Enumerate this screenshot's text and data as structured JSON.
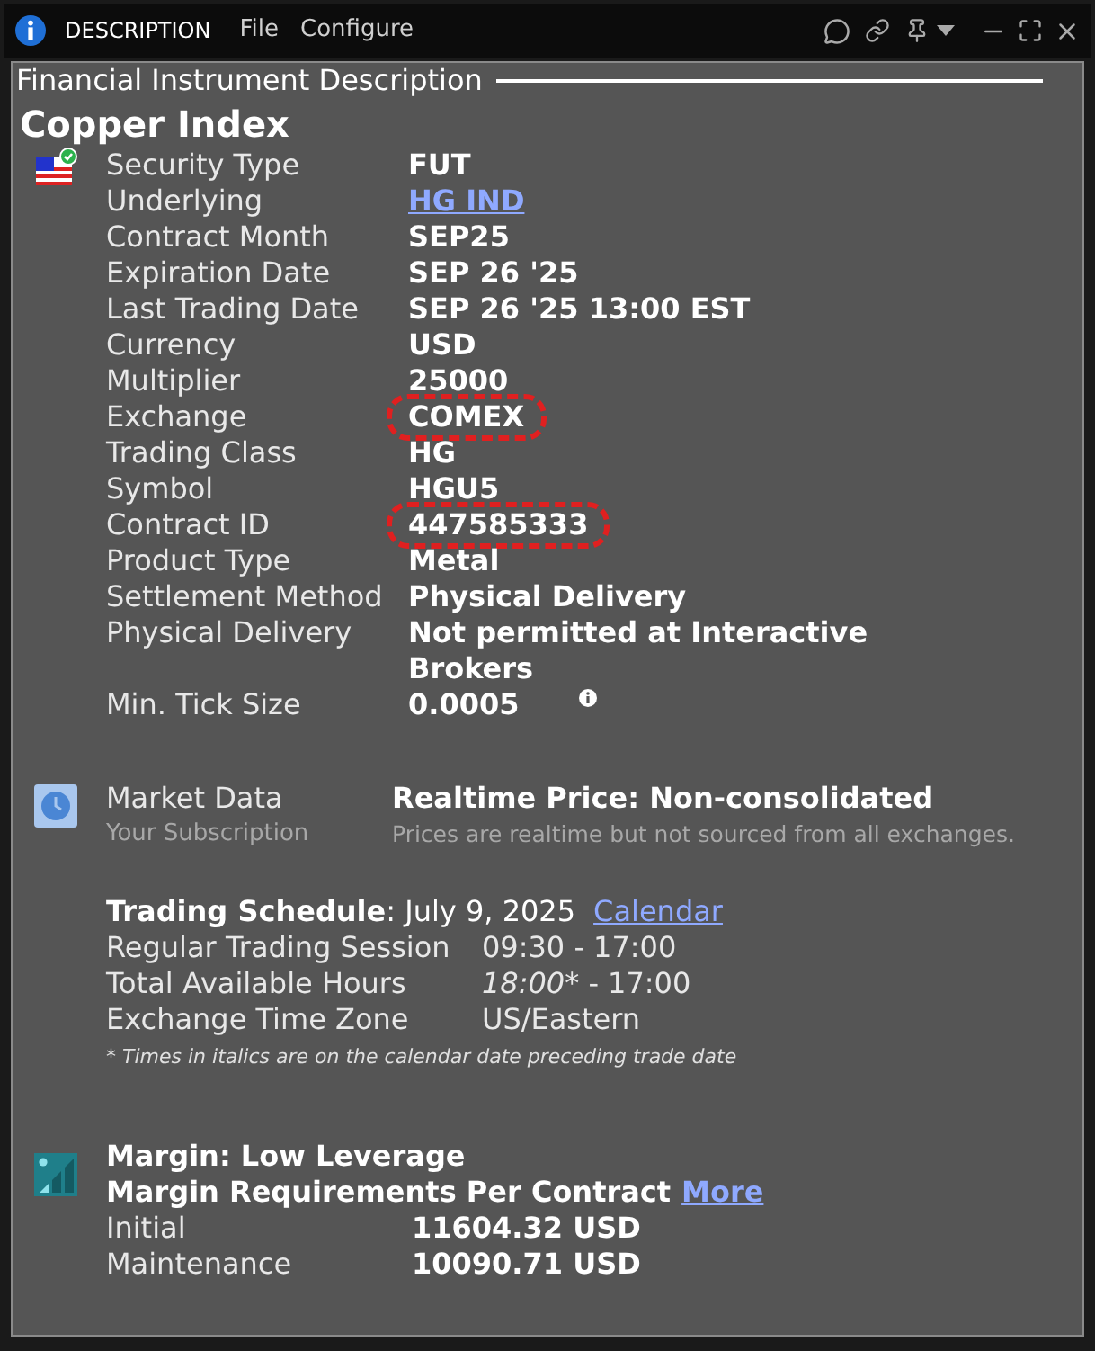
{
  "window": {
    "title": "DESCRIPTION",
    "menu": [
      "File",
      "Configure"
    ]
  },
  "section_title": "Financial Instrument Description",
  "instrument": {
    "name": "Copper Index",
    "details": [
      {
        "label": "Security Type",
        "value": "FUT",
        "kind": "text",
        "highlighted": false
      },
      {
        "label": "Underlying",
        "value": "HG IND",
        "kind": "link",
        "highlighted": false
      },
      {
        "label": "Contract Month",
        "value": "SEP25",
        "kind": "text",
        "highlighted": false
      },
      {
        "label": "Expiration Date",
        "value": "SEP 26 '25",
        "kind": "text",
        "highlighted": false
      },
      {
        "label": "Last Trading Date",
        "value": "SEP 26 '25 13:00 EST",
        "kind": "text",
        "highlighted": false
      },
      {
        "label": "Currency",
        "value": "USD",
        "kind": "text",
        "highlighted": false
      },
      {
        "label": "Multiplier",
        "value": "25000",
        "kind": "text",
        "highlighted": false
      },
      {
        "label": "Exchange",
        "value": "COMEX",
        "kind": "text",
        "highlighted": true
      },
      {
        "label": "Trading Class",
        "value": "HG",
        "kind": "text",
        "highlighted": false
      },
      {
        "label": "Symbol",
        "value": "HGU5",
        "kind": "text",
        "highlighted": false
      },
      {
        "label": "Contract ID",
        "value": "447585333",
        "kind": "text",
        "highlighted": true
      },
      {
        "label": "Product Type",
        "value": "Metal",
        "kind": "text",
        "highlighted": false
      },
      {
        "label": "Settlement Method",
        "value": "Physical Delivery",
        "kind": "text",
        "highlighted": false
      },
      {
        "label": "Physical Delivery",
        "value": "Not permitted at Interactive Brokers",
        "kind": "text",
        "highlighted": false
      },
      {
        "label": "Min. Tick Size",
        "value": "0.0005",
        "kind": "info",
        "highlighted": false
      }
    ]
  },
  "market_data": {
    "label": "Market Data",
    "sublabel": "Your Subscription",
    "value": "Realtime Price: Non-consolidated",
    "note": "Prices are realtime but not sourced from all exchanges."
  },
  "trading_schedule": {
    "heading": "**Trading Schedule**: July 9, 2025",
    "link": "Calendar",
    "rows": [
      {
        "label": "Regular Trading Session",
        "start": "09:30",
        "start_italic": false,
        "suffix": "",
        "rest": "- 17:00"
      },
      {
        "label": "Total Available Hours",
        "start": "18:00",
        "start_italic": true,
        "suffix": "*",
        "rest": "- 17:00"
      },
      {
        "label": "Exchange Time Zone",
        "start": "US/Eastern",
        "start_italic": false,
        "suffix": "",
        "rest": ""
      }
    ],
    "footnote": "* Times in italics are on the calendar date preceding trade date"
  },
  "margin": {
    "title": "Margin: Low Leverage",
    "subtitle": "Margin Requirements Per Contract",
    "link": "More",
    "rows": [
      {
        "label": "Initial",
        "value": "11604.32 USD"
      },
      {
        "label": "Maintenance",
        "value": "10090.71 USD"
      }
    ]
  }
}
